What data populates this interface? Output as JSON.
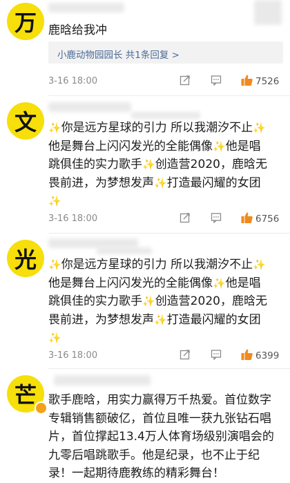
{
  "comments": [
    {
      "avatar_char": "万",
      "text": "鹿晗给我冲",
      "reply_label": "小鹿动物园园长 共1条回复 >",
      "time": "3-16 18:00",
      "likes": "7526"
    },
    {
      "avatar_char": "文",
      "lines": [
        "你是远方星球的引力 所以我潮汐不止",
        "他是舞台上闪闪发光的全能偶像",
        "他是唱",
        "跳俱佳的实力歌手",
        "创造营2020，鹿晗无",
        "畏前进，为梦想发声",
        "打造最闪耀的女团"
      ],
      "time": "3-16 18:00",
      "likes": "6756"
    },
    {
      "avatar_char": "光",
      "lines": [
        "你是远方星球的引力 所以我潮汐不止",
        "他是舞台上闪闪发光的全能偶像",
        "他是唱",
        "跳俱佳的实力歌手",
        "创造营2020，鹿晗无",
        "畏前进，为梦想发声",
        "打造最闪耀的女团"
      ],
      "time": "3-16 18:00",
      "likes": "6399"
    },
    {
      "avatar_char": "芒",
      "lines": [
        "歌手鹿晗，用实力赢得万千热爱。首位数字",
        "专辑销售额破亿，首位且唯一获九张钻石唱",
        "片，首位撑起13.4万人体育场级别演唱会的",
        "九零后唱跳歌手。他是纪录，也不止于纪",
        "录！一起期待鹿教练的精彩舞台！"
      ]
    }
  ],
  "icons": {
    "share": "share-icon",
    "comment": "comment-icon",
    "like": "thumbs-up-icon",
    "sparkle": "sparkle-icon"
  },
  "colors": {
    "avatar_bg": "#f6df0a",
    "like_orange": "#f08a1c",
    "link_blue": "#4b6a98",
    "sparkle": "#e9bd27"
  }
}
